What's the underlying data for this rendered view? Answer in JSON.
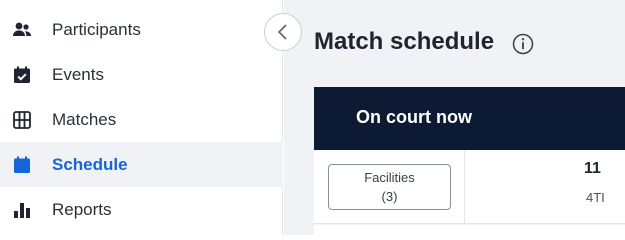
{
  "sidebar": {
    "items": [
      {
        "label": "Participants",
        "icon": "participants-icon",
        "active": false
      },
      {
        "label": "Events",
        "icon": "calendar-check-icon",
        "active": false
      },
      {
        "label": "Matches",
        "icon": "grid-icon",
        "active": false
      },
      {
        "label": "Schedule",
        "icon": "calendar-icon",
        "active": true
      },
      {
        "label": "Reports",
        "icon": "bar-chart-icon",
        "active": false
      }
    ],
    "collapse_icon": "chevron-left-icon"
  },
  "main": {
    "title": "Match schedule",
    "info_icon": "info-icon",
    "section_header": "On court now",
    "facilities": {
      "label": "Facilities",
      "count": "(3)"
    },
    "court": {
      "number": "11",
      "code": "4TI"
    }
  },
  "colors": {
    "accent": "#1565d8",
    "header_bg": "#0c1a33",
    "active_bg": "#f0f2f5"
  }
}
